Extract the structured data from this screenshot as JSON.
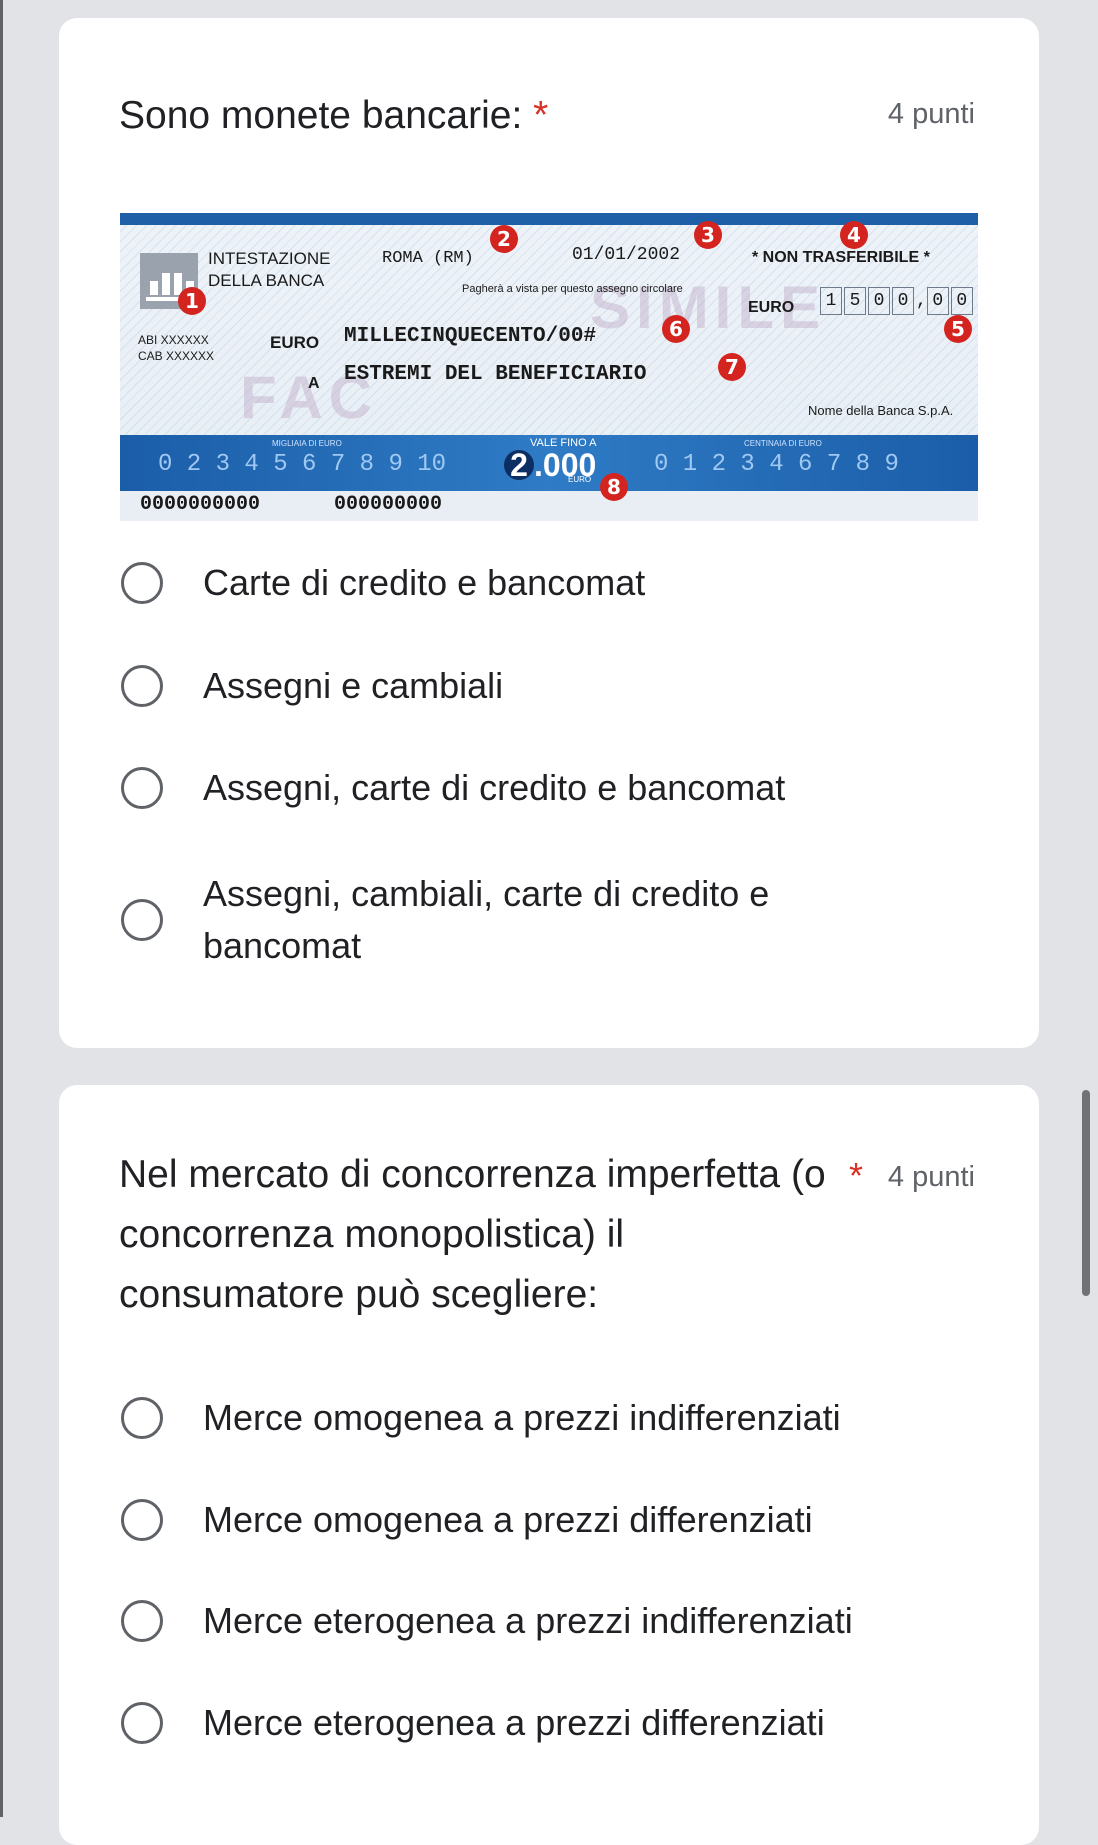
{
  "questions": [
    {
      "title": "Sono monete bancarie:",
      "required_mark": "*",
      "points": "4 punti",
      "options": [
        "Carte di credito e bancomat",
        "Assegni e cambiali",
        "Assegni, carte di credito e bancomat",
        "Assegni, cambiali, carte di credito e bancomat"
      ]
    },
    {
      "title": "Nel mercato di concorrenza imperfetta (o concorrenza monopolistica) il consumatore può scegliere:",
      "required_mark": "*",
      "points": "4 punti",
      "options": [
        "Merce omogenea a prezzi indifferenziati",
        "Merce omogenea a prezzi differenziati",
        "Merce eterogenea a prezzi indifferenziati",
        "Merce eterogenea a prezzi differenziati"
      ]
    }
  ],
  "cheque": {
    "intestazione": "INTESTAZIONE",
    "della_banca": "DELLA BANCA",
    "place": "ROMA (RM)",
    "date": "01/01/2002",
    "non_trasferibile": "* NON TRASFERIBILE *",
    "pagherà": "Pagherà a vista per questo assegno circolare",
    "euro_label": "EURO",
    "amount_digits": [
      "1",
      "5",
      "0",
      "0"
    ],
    "amount_cents": [
      "0",
      "0"
    ],
    "abi": "ABI XXXXXX",
    "cab": "CAB XXXXXX",
    "amount_words": "MILLECINQUECENTO/00#",
    "a_label": "A",
    "beneficiario": "ESTREMI DEL BENEFICIARIO",
    "bank_name": "Nome della Banca S.p.A.",
    "migliaia": "MIGLIAIA DI EURO",
    "migliaia_digits": "0  2 3 4 5 6 7 8 9 10",
    "vale_fino": "VALE FINO A",
    "vale_amount": ".000",
    "vale_amount_first": "2",
    "vale_euro": "EURO",
    "centinaia": "CENTINAIA DI EURO",
    "centinaia_digits": "0 1 2 3 4   6 7 8 9",
    "code1": "0000000000",
    "code2": "000000000",
    "watermark1": "FAC",
    "watermark2": "SIMILE",
    "badges": [
      "1",
      "2",
      "3",
      "4",
      "5",
      "6",
      "7",
      "8"
    ]
  }
}
